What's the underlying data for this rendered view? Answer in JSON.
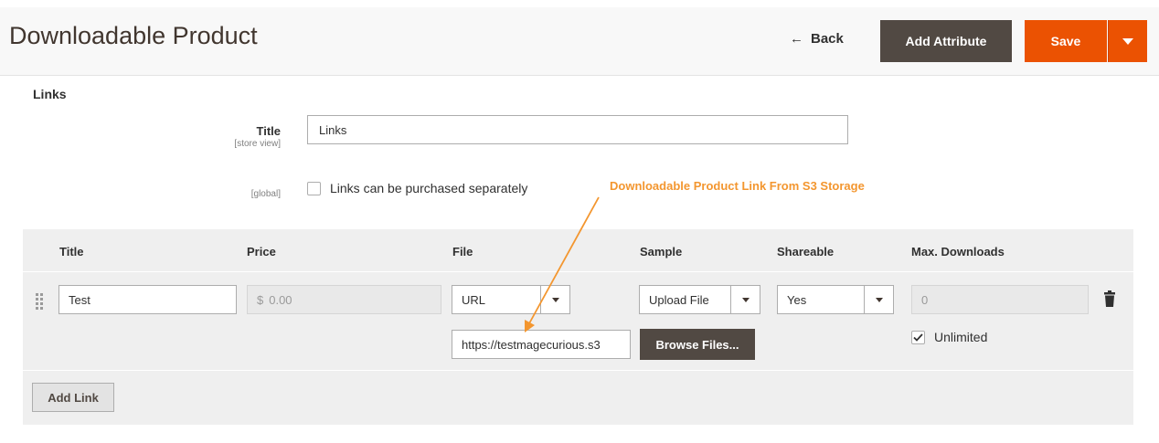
{
  "header": {
    "title": "Downloadable Product",
    "back_label": "Back",
    "add_attribute_label": "Add Attribute",
    "save_label": "Save"
  },
  "links_section": {
    "heading": "Links",
    "title_label": "Title",
    "title_scope": "[store view]",
    "title_value": "Links",
    "global_scope": "[global]",
    "purchase_separately_label": "Links can be purchased separately",
    "purchase_separately_checked": false
  },
  "annotation": {
    "text": "Downloadable Product Link From S3 Storage",
    "color": "#f3962f"
  },
  "grid": {
    "columns": [
      "Title",
      "Price",
      "File",
      "Sample",
      "Shareable",
      "Max. Downloads"
    ],
    "row": {
      "title": "Test",
      "price_currency": "$",
      "price_placeholder": "0.00",
      "file_type": "URL",
      "file_url": "https://testmagecurious.s3",
      "sample": "Upload File",
      "browse_label": "Browse Files...",
      "shareable": "Yes",
      "max_downloads": "0",
      "unlimited_label": "Unlimited",
      "unlimited_checked": true
    },
    "add_link_label": "Add Link"
  },
  "colors": {
    "primary_action": "#eb5202",
    "secondary_action": "#514943",
    "annotation": "#f3962f"
  }
}
